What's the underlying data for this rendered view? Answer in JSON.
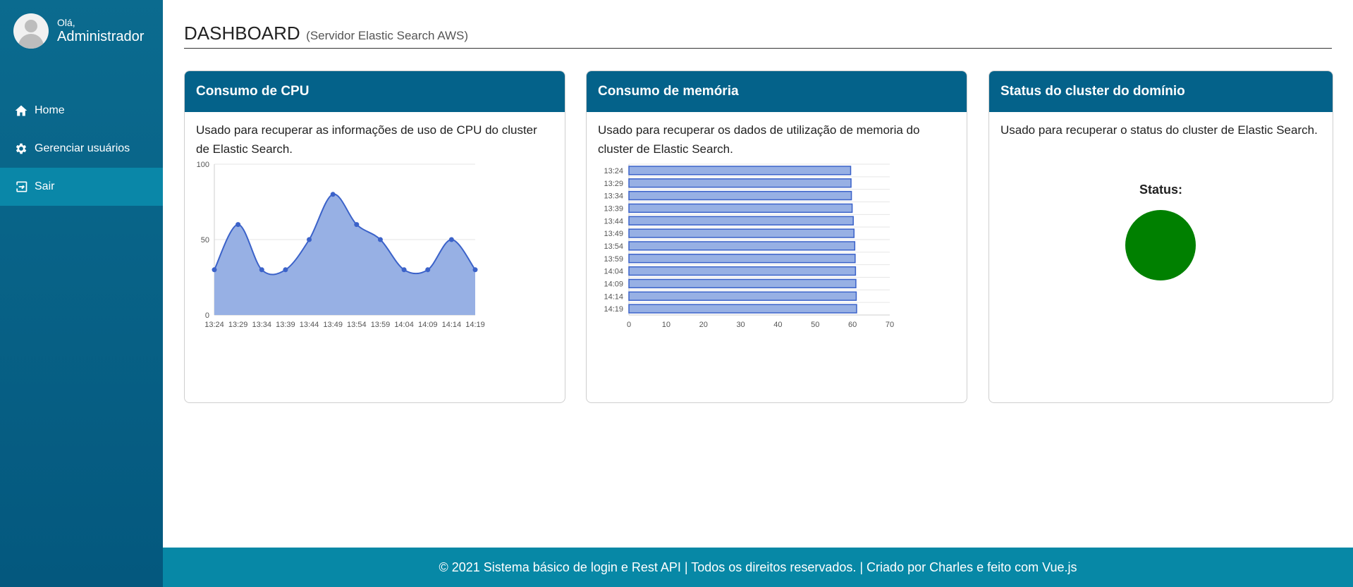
{
  "sidebar": {
    "greeting": "Olá,",
    "user_name": "Administrador",
    "items": [
      {
        "label": "Home",
        "icon": "home-icon"
      },
      {
        "label": "Gerenciar usuários",
        "icon": "gear-icon"
      },
      {
        "label": "Sair",
        "icon": "logout-icon"
      }
    ]
  },
  "header": {
    "title": "DASHBOARD",
    "subtitle": "(Servidor Elastic Search AWS)"
  },
  "cards": {
    "cpu": {
      "title": "Consumo de CPU",
      "description": "Usado para recuperar as informações de uso de CPU do cluster de Elastic Search."
    },
    "memory": {
      "title": "Consumo de memória",
      "description": "Usado para recuperar os dados de utilização de memoria do cluster de Elastic Search."
    },
    "status": {
      "title": "Status do cluster do domínio",
      "description": "Usado para recuperar o status do cluster de Elastic Search.",
      "status_label": "Status:",
      "status_color": "#008000"
    }
  },
  "chart_data": [
    {
      "type": "area",
      "x": [
        "13:24",
        "13:29",
        "13:34",
        "13:39",
        "13:44",
        "13:49",
        "13:54",
        "13:59",
        "14:04",
        "14:09",
        "14:14",
        "14:19"
      ],
      "series": [
        {
          "values": [
            30,
            60,
            30,
            30,
            50,
            80,
            60,
            50,
            30,
            30,
            50,
            30
          ]
        }
      ],
      "ylim": [
        0,
        100
      ],
      "yticks": [
        0,
        50,
        100
      ],
      "color": "#3b62c9",
      "fill": "#97b0e4"
    },
    {
      "type": "bar",
      "orientation": "horizontal",
      "categories": [
        "13:24",
        "13:29",
        "13:34",
        "13:39",
        "13:44",
        "13:49",
        "13:54",
        "13:59",
        "14:04",
        "14:09",
        "14:14",
        "14:19"
      ],
      "series": [
        {
          "values": [
            59.5,
            59.6,
            59.7,
            59.9,
            60.2,
            60.4,
            60.6,
            60.7,
            60.8,
            60.9,
            61.0,
            61.1
          ]
        }
      ],
      "xlim": [
        0,
        70
      ],
      "xticks": [
        0,
        10,
        20,
        30,
        40,
        50,
        60,
        70
      ],
      "color": "#3b62c9",
      "fill": "#97b0e4"
    }
  ],
  "footer": {
    "text": "© 2021 Sistema básico de login e Rest API | Todos os direitos reservados. | Criado por Charles e feito com Vue.js"
  }
}
